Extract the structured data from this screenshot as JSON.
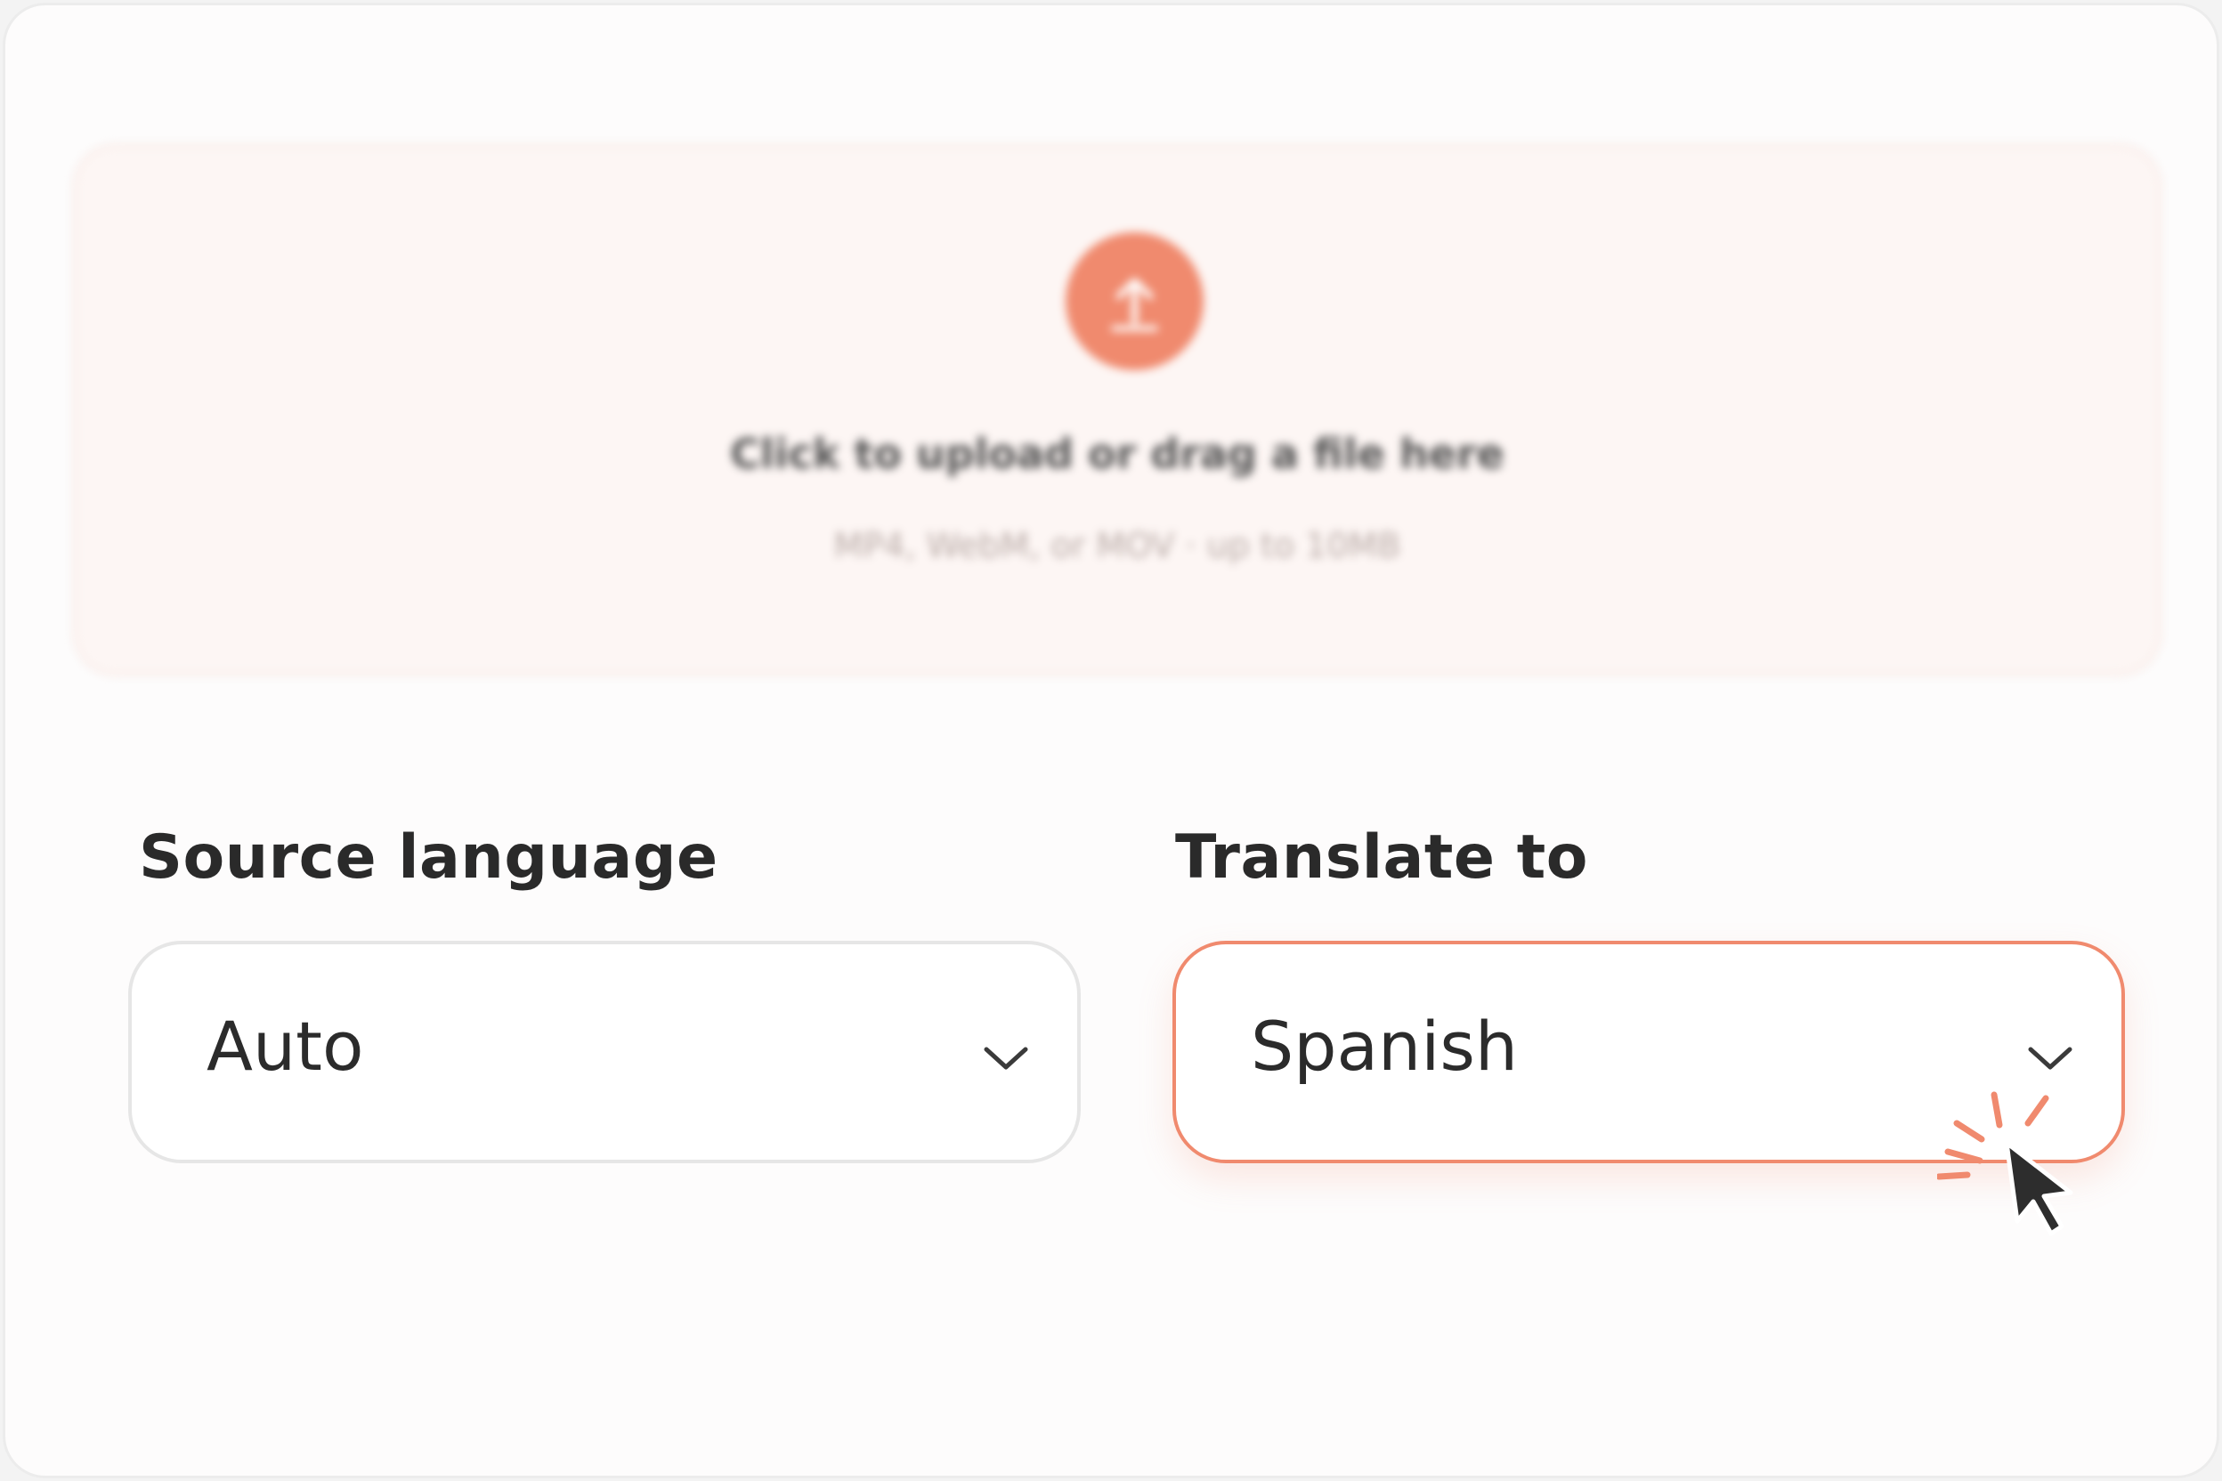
{
  "upload": {
    "icon": "upload-arrow-icon",
    "title": "Click to upload or drag a file here",
    "hint": "MP4, WebM, or MOV · up to 10MB"
  },
  "source": {
    "label": "Source language",
    "value": "Auto",
    "icon": "chevron-down-icon"
  },
  "target": {
    "label": "Translate to",
    "value": "Spanish",
    "icon": "chevron-down-icon",
    "state": "focused"
  },
  "colors": {
    "accent": "#f08a6e",
    "text": "#2a2a2a",
    "border": "#e6e6e6"
  },
  "cursor": {
    "icon": "mouse-pointer-click-icon"
  }
}
